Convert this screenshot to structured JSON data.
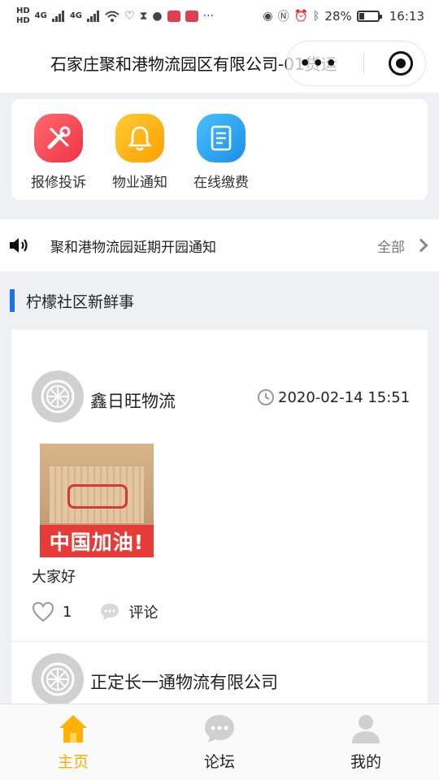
{
  "status_bar": {
    "left_chips": [
      "HD",
      "HD"
    ],
    "network_labels": [
      "4G",
      "4G"
    ],
    "battery_percent": "28%",
    "time": "16:13"
  },
  "nav": {
    "title": "石家庄聚和港物流园区有限公司-01货运"
  },
  "services": [
    {
      "label": "报修投诉",
      "icon": "tools-icon",
      "color": "#f2464f"
    },
    {
      "label": "物业通知",
      "icon": "bell-icon",
      "color": "#ffb21c"
    },
    {
      "label": "在线缴费",
      "icon": "bill-icon",
      "color": "#2ea6f2"
    }
  ],
  "notice": {
    "text": "聚和港物流园延期开园通知",
    "all_label": "全部"
  },
  "section": {
    "title": "柠檬社区新鲜事"
  },
  "posts": [
    {
      "author": "鑫日旺物流",
      "time": "2020-02-14 15:51",
      "image_banner": "中国加油!",
      "text": "大家好",
      "likes": "1",
      "comment_label": "评论"
    },
    {
      "author": "正定长一通物流有限公司"
    }
  ],
  "tabs": [
    {
      "label": "主页",
      "icon": "home-icon",
      "active": true
    },
    {
      "label": "论坛",
      "icon": "chat-bubble-icon",
      "active": false
    },
    {
      "label": "我的",
      "icon": "user-icon",
      "active": false
    }
  ],
  "colors": {
    "accent_blue": "#1a73e8",
    "active_tab": "#f5b000"
  }
}
